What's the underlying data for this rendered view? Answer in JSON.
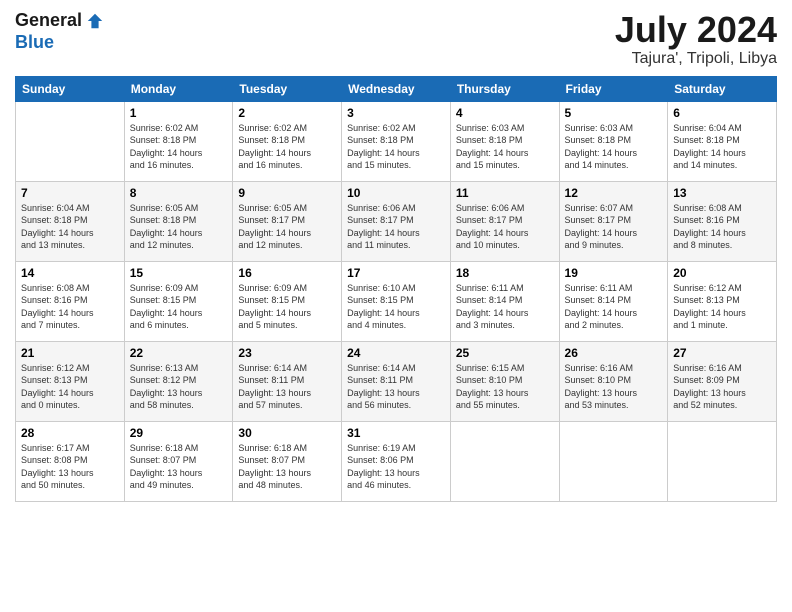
{
  "header": {
    "logo_line1": "General",
    "logo_line2": "Blue",
    "month": "July 2024",
    "location": "Tajura', Tripoli, Libya"
  },
  "weekdays": [
    "Sunday",
    "Monday",
    "Tuesday",
    "Wednesday",
    "Thursday",
    "Friday",
    "Saturday"
  ],
  "weeks": [
    [
      {
        "day": "",
        "info": ""
      },
      {
        "day": "1",
        "info": "Sunrise: 6:02 AM\nSunset: 8:18 PM\nDaylight: 14 hours\nand 16 minutes."
      },
      {
        "day": "2",
        "info": "Sunrise: 6:02 AM\nSunset: 8:18 PM\nDaylight: 14 hours\nand 16 minutes."
      },
      {
        "day": "3",
        "info": "Sunrise: 6:02 AM\nSunset: 8:18 PM\nDaylight: 14 hours\nand 15 minutes."
      },
      {
        "day": "4",
        "info": "Sunrise: 6:03 AM\nSunset: 8:18 PM\nDaylight: 14 hours\nand 15 minutes."
      },
      {
        "day": "5",
        "info": "Sunrise: 6:03 AM\nSunset: 8:18 PM\nDaylight: 14 hours\nand 14 minutes."
      },
      {
        "day": "6",
        "info": "Sunrise: 6:04 AM\nSunset: 8:18 PM\nDaylight: 14 hours\nand 14 minutes."
      }
    ],
    [
      {
        "day": "7",
        "info": "Sunrise: 6:04 AM\nSunset: 8:18 PM\nDaylight: 14 hours\nand 13 minutes."
      },
      {
        "day": "8",
        "info": "Sunrise: 6:05 AM\nSunset: 8:18 PM\nDaylight: 14 hours\nand 12 minutes."
      },
      {
        "day": "9",
        "info": "Sunrise: 6:05 AM\nSunset: 8:17 PM\nDaylight: 14 hours\nand 12 minutes."
      },
      {
        "day": "10",
        "info": "Sunrise: 6:06 AM\nSunset: 8:17 PM\nDaylight: 14 hours\nand 11 minutes."
      },
      {
        "day": "11",
        "info": "Sunrise: 6:06 AM\nSunset: 8:17 PM\nDaylight: 14 hours\nand 10 minutes."
      },
      {
        "day": "12",
        "info": "Sunrise: 6:07 AM\nSunset: 8:17 PM\nDaylight: 14 hours\nand 9 minutes."
      },
      {
        "day": "13",
        "info": "Sunrise: 6:08 AM\nSunset: 8:16 PM\nDaylight: 14 hours\nand 8 minutes."
      }
    ],
    [
      {
        "day": "14",
        "info": "Sunrise: 6:08 AM\nSunset: 8:16 PM\nDaylight: 14 hours\nand 7 minutes."
      },
      {
        "day": "15",
        "info": "Sunrise: 6:09 AM\nSunset: 8:15 PM\nDaylight: 14 hours\nand 6 minutes."
      },
      {
        "day": "16",
        "info": "Sunrise: 6:09 AM\nSunset: 8:15 PM\nDaylight: 14 hours\nand 5 minutes."
      },
      {
        "day": "17",
        "info": "Sunrise: 6:10 AM\nSunset: 8:15 PM\nDaylight: 14 hours\nand 4 minutes."
      },
      {
        "day": "18",
        "info": "Sunrise: 6:11 AM\nSunset: 8:14 PM\nDaylight: 14 hours\nand 3 minutes."
      },
      {
        "day": "19",
        "info": "Sunrise: 6:11 AM\nSunset: 8:14 PM\nDaylight: 14 hours\nand 2 minutes."
      },
      {
        "day": "20",
        "info": "Sunrise: 6:12 AM\nSunset: 8:13 PM\nDaylight: 14 hours\nand 1 minute."
      }
    ],
    [
      {
        "day": "21",
        "info": "Sunrise: 6:12 AM\nSunset: 8:13 PM\nDaylight: 14 hours\nand 0 minutes."
      },
      {
        "day": "22",
        "info": "Sunrise: 6:13 AM\nSunset: 8:12 PM\nDaylight: 13 hours\nand 58 minutes."
      },
      {
        "day": "23",
        "info": "Sunrise: 6:14 AM\nSunset: 8:11 PM\nDaylight: 13 hours\nand 57 minutes."
      },
      {
        "day": "24",
        "info": "Sunrise: 6:14 AM\nSunset: 8:11 PM\nDaylight: 13 hours\nand 56 minutes."
      },
      {
        "day": "25",
        "info": "Sunrise: 6:15 AM\nSunset: 8:10 PM\nDaylight: 13 hours\nand 55 minutes."
      },
      {
        "day": "26",
        "info": "Sunrise: 6:16 AM\nSunset: 8:10 PM\nDaylight: 13 hours\nand 53 minutes."
      },
      {
        "day": "27",
        "info": "Sunrise: 6:16 AM\nSunset: 8:09 PM\nDaylight: 13 hours\nand 52 minutes."
      }
    ],
    [
      {
        "day": "28",
        "info": "Sunrise: 6:17 AM\nSunset: 8:08 PM\nDaylight: 13 hours\nand 50 minutes."
      },
      {
        "day": "29",
        "info": "Sunrise: 6:18 AM\nSunset: 8:07 PM\nDaylight: 13 hours\nand 49 minutes."
      },
      {
        "day": "30",
        "info": "Sunrise: 6:18 AM\nSunset: 8:07 PM\nDaylight: 13 hours\nand 48 minutes."
      },
      {
        "day": "31",
        "info": "Sunrise: 6:19 AM\nSunset: 8:06 PM\nDaylight: 13 hours\nand 46 minutes."
      },
      {
        "day": "",
        "info": ""
      },
      {
        "day": "",
        "info": ""
      },
      {
        "day": "",
        "info": ""
      }
    ]
  ]
}
